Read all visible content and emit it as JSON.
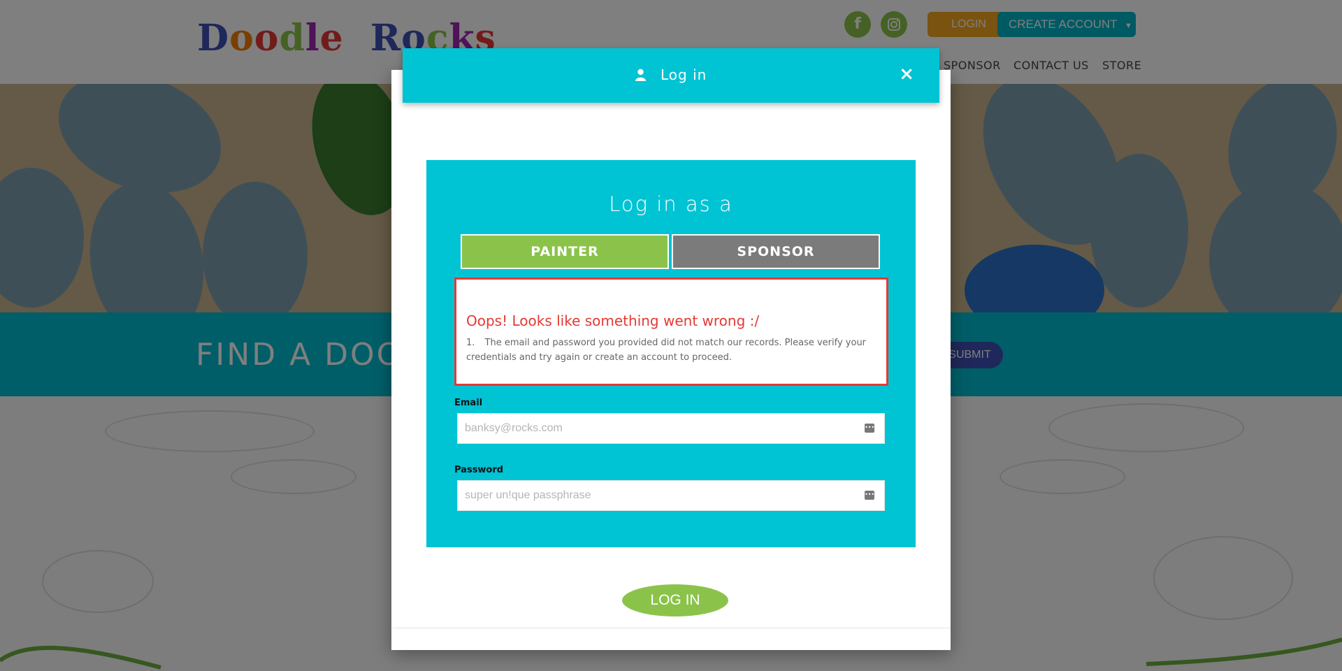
{
  "header": {
    "logo_text": "Doodle Rocks",
    "login_label": "LOGIN",
    "create_account_label": "CREATE ACCOUNT",
    "nav": [
      "SPONSOR",
      "CONTACT US",
      "STORE"
    ]
  },
  "banner": {
    "find_text": "FIND A DOOD",
    "submit_label": "SUBMIT"
  },
  "modal": {
    "title": "Log in",
    "close_symbol": "×",
    "card_title": "Log in as a",
    "roles": [
      {
        "label": "PAINTER",
        "selected": true
      },
      {
        "label": "SPONSOR",
        "selected": false
      }
    ],
    "error": {
      "title": "Oops! Looks like something went wrong :/",
      "items": [
        {
          "num": "1.",
          "text": "The email and password you provided did not match our records. Please verify your credentials and try again or create an account to proceed."
        }
      ]
    },
    "email": {
      "label": "Email",
      "placeholder": "banksy@rocks.com",
      "value": ""
    },
    "password": {
      "label": "Password",
      "placeholder": "super un!que passphrase",
      "value": ""
    },
    "submit_label": "LOG IN"
  },
  "colors": {
    "accent": "#00c3d4",
    "painter_green": "#8bc34a",
    "sponsor_gray": "#7b7b7b",
    "error_red": "#e53935",
    "login_orange": "#f5a623"
  },
  "icons": [
    "facebook-icon",
    "instagram-icon",
    "user-icon",
    "close-icon",
    "password-manager-icon",
    "caret-down-icon"
  ]
}
